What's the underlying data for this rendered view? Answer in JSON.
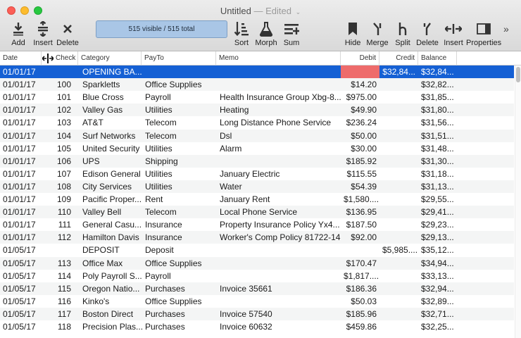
{
  "window": {
    "title": "Untitled",
    "edited": "— Edited"
  },
  "toolbar": {
    "add": "Add",
    "insert": "Insert",
    "delete": "Delete",
    "status": "515 visible / 515 total",
    "sort": "Sort",
    "morph": "Morph",
    "sum": "Sum",
    "hide": "Hide",
    "merge": "Merge",
    "split": "Split",
    "delete2": "Delete",
    "insert2": "Insert",
    "properties": "Properties",
    "overflow": "»"
  },
  "columns": [
    "Date",
    "Check",
    "Category",
    "PayTo",
    "Memo",
    "Debit",
    "Credit",
    "Balance"
  ],
  "rows": [
    {
      "date": "01/01/17",
      "check": "",
      "category": "OPENING BA...",
      "payto": "",
      "memo": "",
      "debit": "",
      "credit": "$32,84...",
      "balance": "$32,84...",
      "selected": true,
      "flag": true
    },
    {
      "date": "01/01/17",
      "check": "100",
      "category": "Sparkletts",
      "payto": "Office Supplies",
      "memo": "",
      "debit": "$14.20",
      "credit": "",
      "balance": "$32,82..."
    },
    {
      "date": "01/01/17",
      "check": "101",
      "category": "Blue Cross",
      "payto": "Payroll",
      "memo": "Health Insurance Group Xbg-8...",
      "debit": "$975.00",
      "credit": "",
      "balance": "$31,85..."
    },
    {
      "date": "01/01/17",
      "check": "102",
      "category": "Valley Gas",
      "payto": "Utilities",
      "memo": "Heating",
      "debit": "$49.90",
      "credit": "",
      "balance": "$31,80..."
    },
    {
      "date": "01/01/17",
      "check": "103",
      "category": "AT&T",
      "payto": "Telecom",
      "memo": "Long Distance Phone Service",
      "debit": "$236.24",
      "credit": "",
      "balance": "$31,56..."
    },
    {
      "date": "01/01/17",
      "check": "104",
      "category": "Surf Networks",
      "payto": "Telecom",
      "memo": "Dsl",
      "debit": "$50.00",
      "credit": "",
      "balance": "$31,51..."
    },
    {
      "date": "01/01/17",
      "check": "105",
      "category": "United Security",
      "payto": "Utilities",
      "memo": "Alarm",
      "debit": "$30.00",
      "credit": "",
      "balance": "$31,48..."
    },
    {
      "date": "01/01/17",
      "check": "106",
      "category": "UPS",
      "payto": "Shipping",
      "memo": "",
      "debit": "$185.92",
      "credit": "",
      "balance": "$31,30..."
    },
    {
      "date": "01/01/17",
      "check": "107",
      "category": "Edison General",
      "payto": "Utilities",
      "memo": "January Electric",
      "debit": "$115.55",
      "credit": "",
      "balance": "$31,18..."
    },
    {
      "date": "01/01/17",
      "check": "108",
      "category": "City Services",
      "payto": "Utilities",
      "memo": "Water",
      "debit": "$54.39",
      "credit": "",
      "balance": "$31,13..."
    },
    {
      "date": "01/01/17",
      "check": "109",
      "category": "Pacific Proper...",
      "payto": "Rent",
      "memo": "January Rent",
      "debit": "$1,580....",
      "credit": "",
      "balance": "$29,55..."
    },
    {
      "date": "01/01/17",
      "check": "110",
      "category": "Valley Bell",
      "payto": "Telecom",
      "memo": "Local Phone Service",
      "debit": "$136.95",
      "credit": "",
      "balance": "$29,41..."
    },
    {
      "date": "01/01/17",
      "check": "111",
      "category": "General Casu...",
      "payto": "Insurance",
      "memo": "Property Insurance Policy Yx4...",
      "debit": "$187.50",
      "credit": "",
      "balance": "$29,23..."
    },
    {
      "date": "01/01/17",
      "check": "112",
      "category": "Hamilton Davis",
      "payto": "Insurance",
      "memo": "Worker's Comp Policy 81722-14",
      "debit": "$92.00",
      "credit": "",
      "balance": "$29,13..."
    },
    {
      "date": "01/05/17",
      "check": "",
      "category": "DEPOSIT",
      "payto": "Deposit",
      "memo": "",
      "debit": "",
      "credit": "$5,985....",
      "balance": "$35,12..."
    },
    {
      "date": "01/05/17",
      "check": "113",
      "category": "Office Max",
      "payto": "Office Supplies",
      "memo": "",
      "debit": "$170.47",
      "credit": "",
      "balance": "$34,94..."
    },
    {
      "date": "01/05/17",
      "check": "114",
      "category": "Poly Payroll S...",
      "payto": "Payroll",
      "memo": "",
      "debit": "$1,817....",
      "credit": "",
      "balance": "$33,13..."
    },
    {
      "date": "01/05/17",
      "check": "115",
      "category": "Oregon Natio...",
      "payto": "Purchases",
      "memo": "Invoice 35661",
      "debit": "$186.36",
      "credit": "",
      "balance": "$32,94..."
    },
    {
      "date": "01/05/17",
      "check": "116",
      "category": "Kinko's",
      "payto": "Office Supplies",
      "memo": "",
      "debit": "$50.03",
      "credit": "",
      "balance": "$32,89..."
    },
    {
      "date": "01/05/17",
      "check": "117",
      "category": "Boston Direct",
      "payto": "Purchases",
      "memo": "Invoice 57540",
      "debit": "$185.96",
      "credit": "",
      "balance": "$32,71..."
    },
    {
      "date": "01/05/17",
      "check": "118",
      "category": "Precision Plas...",
      "payto": "Purchases",
      "memo": "Invoice 60632",
      "debit": "$459.86",
      "credit": "",
      "balance": "$32,25..."
    }
  ]
}
